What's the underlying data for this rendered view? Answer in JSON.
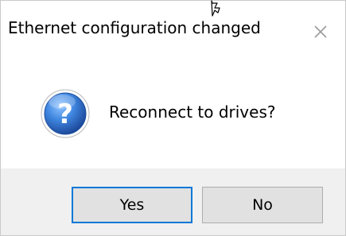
{
  "dialog": {
    "title": "Ethernet configuration changed",
    "message": "Reconnect to drives?",
    "icon": "question-icon",
    "buttons": {
      "yes": "Yes",
      "no": "No"
    }
  },
  "colors": {
    "focus_border": "#0078d7",
    "footer_bg": "#f0f0f0",
    "button_bg": "#e1e1e1",
    "icon_blue": "#2f6fc4"
  }
}
